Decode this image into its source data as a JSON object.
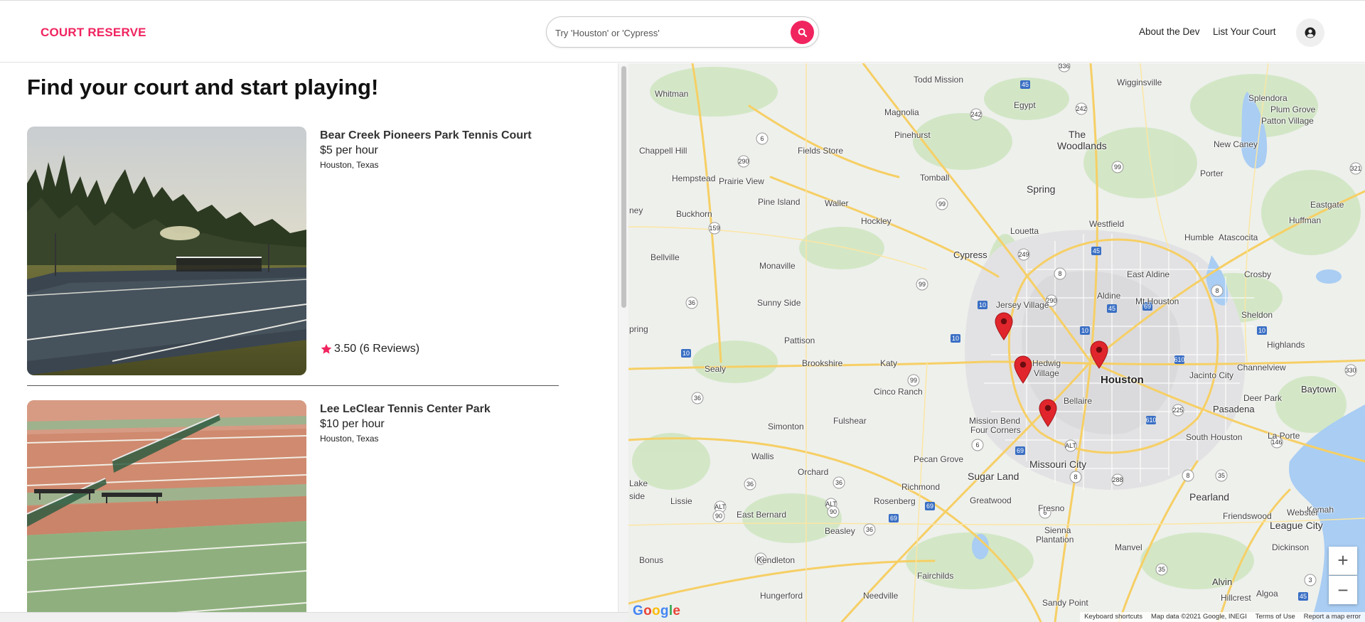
{
  "header": {
    "logo": "COURT RESERVE",
    "search_placeholder": "Try 'Houston' or 'Cypress'",
    "nav": [
      "About the Dev",
      "List Your Court"
    ]
  },
  "main": {
    "title": "Find your court and start playing!"
  },
  "listings": [
    {
      "name": "Bear Creek Pioneers Park Tennis Court",
      "price": "$5 per hour",
      "location": "Houston, Texas",
      "rating": "3.50 (6 Reviews)"
    },
    {
      "name": "Lee LeClear Tennis Center Park",
      "price": "$10 per hour",
      "location": "Houston, Texas"
    }
  ],
  "map": {
    "places": [
      "Todd Mission",
      "Wigginsville",
      "Whitman",
      "Magnolia",
      "Egypt",
      "Splendora",
      "Plum Grove",
      "Patton Village",
      "Pinehurst",
      "The",
      "Woodlands",
      "New Caney",
      "Chappell Hill",
      "Fields Store",
      "Hempstead",
      "Prairie View",
      "Tomball",
      "Porter",
      "Spring",
      "Pine Island",
      "Waller",
      "Eastgate",
      "Huffman",
      "Buckhorn",
      "Hockley",
      "Westfield",
      "Humble",
      "Atascocita",
      "Louetta",
      "Bellville",
      "Cypress",
      "Monaville",
      "Aldine",
      "East Aldine",
      "Crosby",
      "Jersey Village",
      "Mt Houston",
      "Sunny Side",
      "Sheldon",
      "Pattison",
      "Highlands",
      "Brookshire",
      "Katy",
      "Hedwig",
      "Village",
      "Houston",
      "Channelview",
      "Sealy",
      "Jacinto City",
      "Baytown",
      "Cinco Ranch",
      "Bellaire",
      "Pasadena",
      "Deer Park",
      "Fulshear",
      "Mission Bend",
      "Four Corners",
      "Simonton",
      "South Houston",
      "La Porte",
      "Wallis",
      "Pecan Grove",
      "Missouri City",
      "Orchard",
      "Sugar Land",
      "Richmond",
      "Lake",
      "side",
      "Lissie",
      "Rosenberg",
      "Greatwood",
      "Pearland",
      "East Bernard",
      "Kemah",
      "Webster",
      "Friendswood",
      "League City",
      "Beasley",
      "Fresno",
      "Sienna",
      "Plantation",
      "Manvel",
      "Dickinson",
      "Bonus",
      "Kendleton",
      "Hungerford",
      "Fairchilds",
      "Needville",
      "Sandy Point",
      "Hillcrest",
      "Algoa",
      "Alvin",
      "pring",
      "ney"
    ],
    "attribution": [
      "Keyboard shortcuts",
      "Map data ©2021 Google, INEGI",
      "Terms of Use",
      "Report a map error"
    ],
    "logo": "Google",
    "zoom_in": "+",
    "zoom_out": "−"
  },
  "colors": {
    "brand": "#f0245f",
    "pin": "#e0262c"
  }
}
